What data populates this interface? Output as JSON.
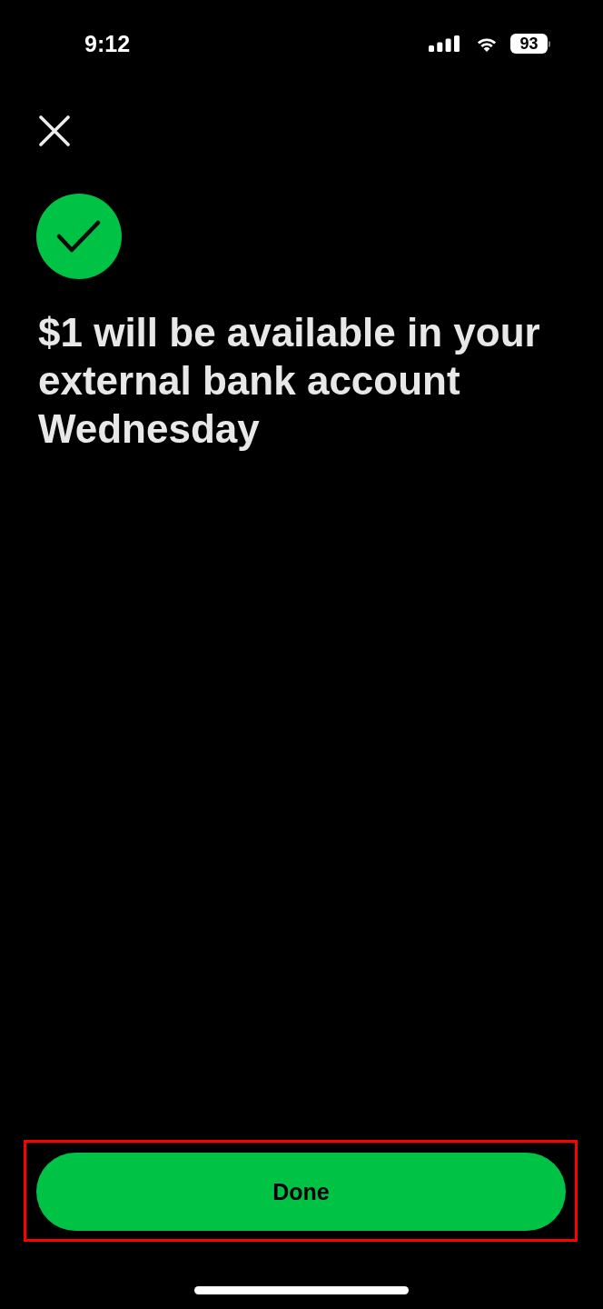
{
  "status_bar": {
    "time": "9:12",
    "battery": "93"
  },
  "message": {
    "text": "$1 will be available in your external bank account Wednesday"
  },
  "done_button": {
    "label": "Done",
    "highlighted": true
  }
}
